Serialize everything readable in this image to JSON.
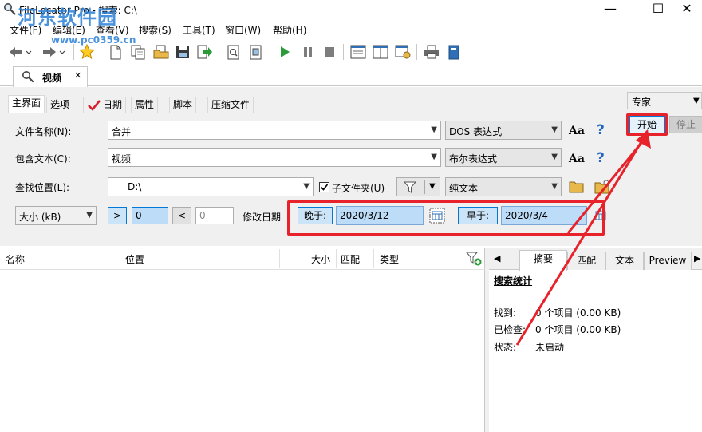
{
  "window": {
    "title": "FileLocator Pro - 搜索: C:\\",
    "controls": {
      "minimize": "—",
      "maximize": "☐",
      "close": "✕"
    }
  },
  "watermark": {
    "site_name": "河东软件园",
    "url": "www.pc0359.cn"
  },
  "menu": [
    "文件(F)",
    "编辑(E)",
    "查看(V)",
    "搜索(S)",
    "工具(T)",
    "窗口(W)",
    "帮助(H)"
  ],
  "doc_tab": {
    "label": "视频",
    "close": "✕"
  },
  "criteria_tabs": [
    "主界面",
    "选项",
    "日期",
    "属性",
    "脚本",
    "压缩文件"
  ],
  "criteria": {
    "file_name": {
      "label": "文件名称(N):",
      "value": "合并",
      "mode": "DOS 表达式"
    },
    "contains_text": {
      "label": "包含文本(C):",
      "value": "视频",
      "mode": "布尔表达式"
    },
    "look_in": {
      "label": "查找位置(L):",
      "value": "D:\\",
      "subfolders_label": "子文件夹(U)",
      "subfolders_checked": true,
      "mode": "纯文本"
    },
    "size": {
      "unit": "大小 (kB)",
      "gt_label": ">",
      "gt_value": "0",
      "lt_label": "<",
      "lt_value": "0"
    },
    "modified_date": {
      "label": "修改日期",
      "after_label": "晚于:",
      "after_value": "2020/3/12",
      "before_label": "早于:",
      "before_value": "2020/3/4"
    }
  },
  "right_panel": {
    "profile": "专家",
    "start": "开始",
    "stop": "停止"
  },
  "results_columns": [
    "名称",
    "位置",
    "大小",
    "匹配",
    "类型"
  ],
  "side_tabs": [
    "摘要",
    "匹配",
    "文本",
    "Preview"
  ],
  "summary": {
    "heading": "搜索统计",
    "found_label": "找到:",
    "found_value": "0 个项目 (0.00 KB)",
    "checked_label": "已检查:",
    "checked_value": "0 个项目 (0.00 KB)",
    "status_label": "状态:",
    "status_value": "未启动"
  },
  "colors": {
    "annotation": "#e8222a",
    "accent": "#0078d7",
    "watermark": "#2b7fd6"
  }
}
